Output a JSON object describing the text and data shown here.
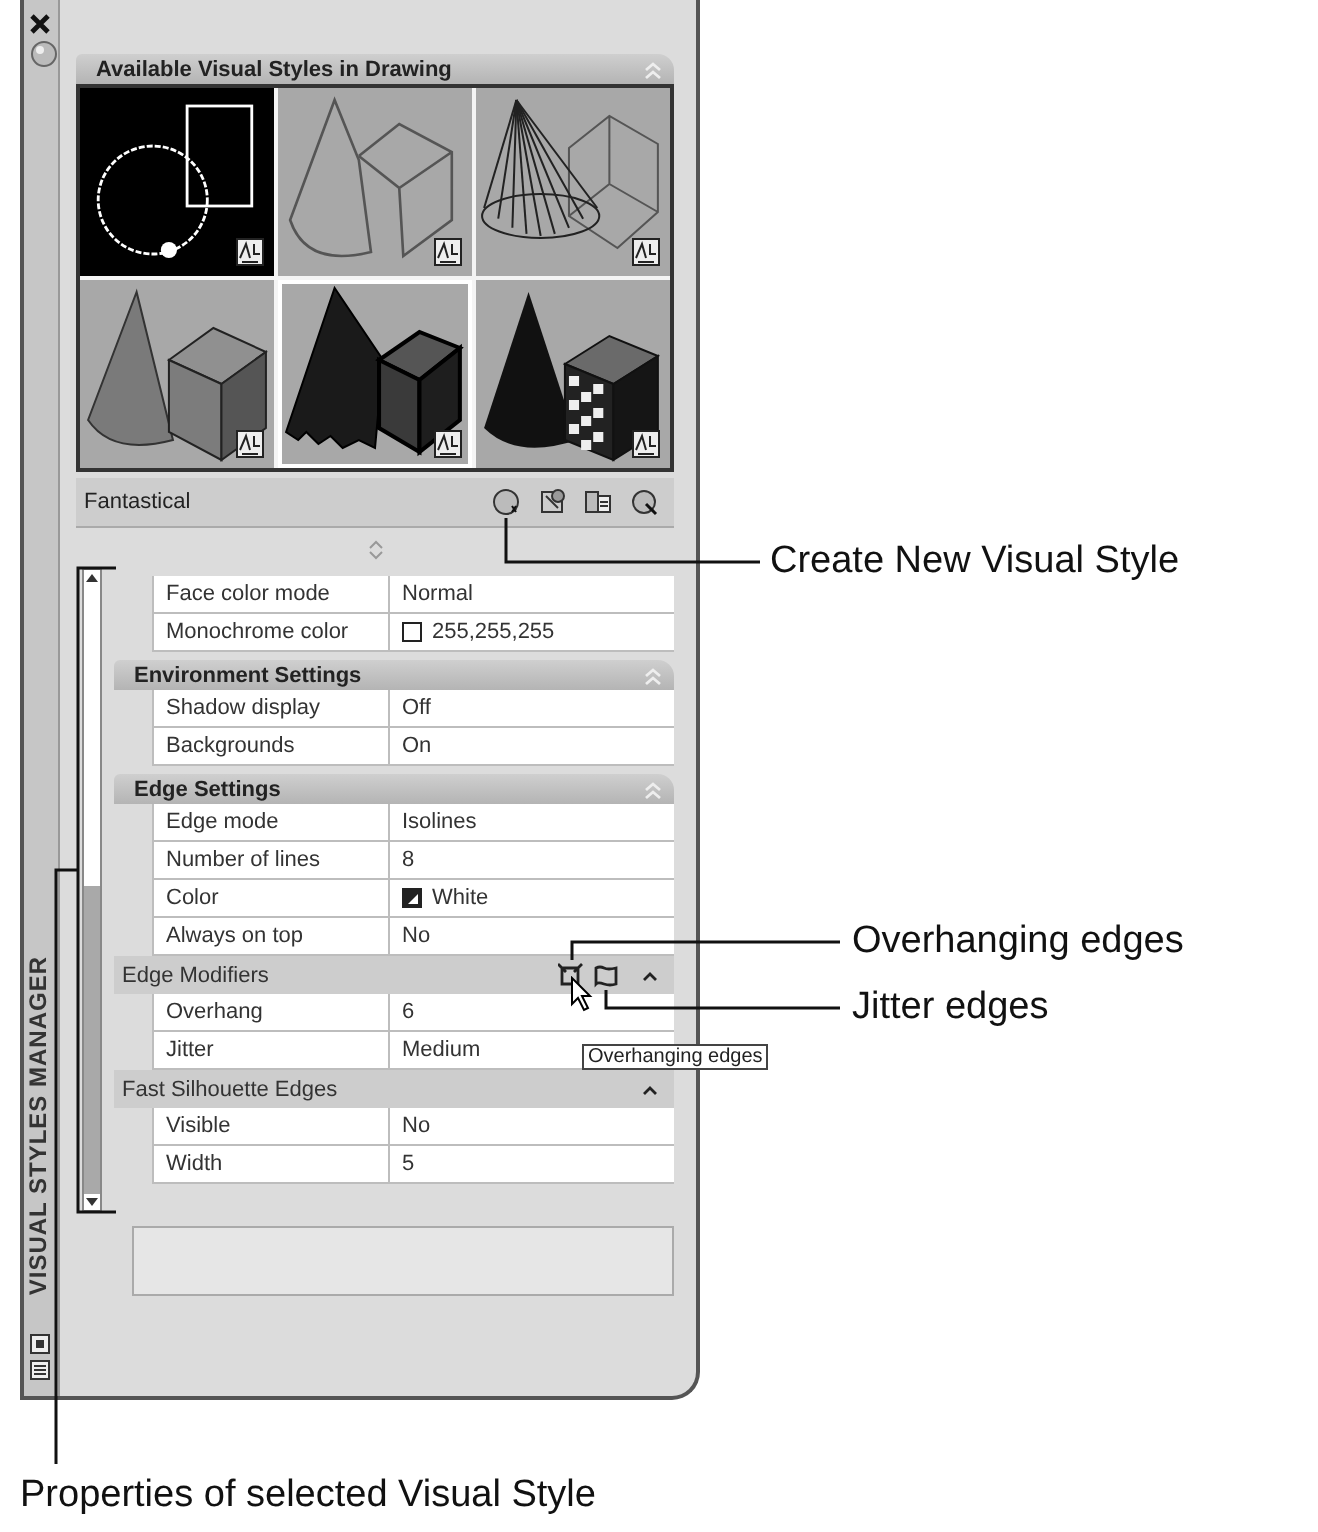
{
  "palette": {
    "title": "VISUAL STYLES MANAGER"
  },
  "styles": {
    "title": "Available Visual Styles in Drawing",
    "current": "Fantastical",
    "thumbnails": [
      {
        "kind": "wireframe-2d",
        "selected": false
      },
      {
        "kind": "hidden",
        "selected": false
      },
      {
        "kind": "wireframe-3d",
        "selected": false
      },
      {
        "kind": "shaded",
        "selected": false
      },
      {
        "kind": "jagged",
        "selected": true
      },
      {
        "kind": "checkered",
        "selected": false
      }
    ]
  },
  "properties": {
    "sections": [
      {
        "kind": "plain",
        "rows": [
          {
            "label": "Face color mode",
            "value": "Normal"
          },
          {
            "label": "Monochrome color",
            "value": "255,255,255",
            "kind": "swatch"
          }
        ]
      },
      {
        "kind": "major",
        "title": "Environment Settings",
        "rows": [
          {
            "label": "Shadow display",
            "value": "Off"
          },
          {
            "label": "Backgrounds",
            "value": "On"
          }
        ]
      },
      {
        "kind": "major",
        "title": "Edge Settings",
        "rows": [
          {
            "label": "Edge mode",
            "value": "Isolines"
          },
          {
            "label": "Number of lines",
            "value": "8"
          },
          {
            "label": "Color",
            "value": "White",
            "kind": "split-swatch"
          },
          {
            "label": "Always on top",
            "value": "No"
          }
        ]
      },
      {
        "kind": "minor",
        "title": "Edge Modifiers",
        "tools": true,
        "tooltip": "Overhanging edges",
        "rows": [
          {
            "label": "Overhang",
            "value": "6"
          },
          {
            "label": "Jitter",
            "value": "Medium"
          }
        ]
      },
      {
        "kind": "minor",
        "title": "Fast Silhouette Edges",
        "rows": [
          {
            "label": "Visible",
            "value": "No"
          },
          {
            "label": "Width",
            "value": "5"
          }
        ]
      }
    ]
  },
  "callouts": [
    {
      "text": "Create New Visual Style"
    },
    {
      "text": "Overhanging edges"
    },
    {
      "text": "Jitter edges"
    },
    {
      "text": "Properties of selected Visual Style"
    }
  ]
}
